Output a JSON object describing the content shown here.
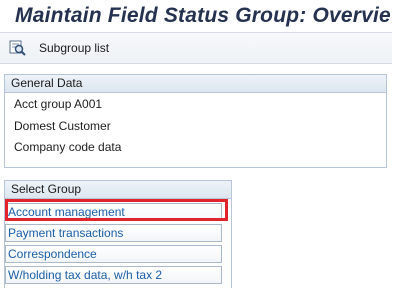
{
  "window": {
    "title": "Maintain Field Status Group: Overview"
  },
  "toolbar": {
    "subgroup_list_label": "Subgroup list",
    "subgroup_list_icon": "magnifier-list-icon"
  },
  "general_data": {
    "header": "General Data",
    "acct_group": "Acct group   A001",
    "description": "Domest  Customer",
    "company_code": "Company code data"
  },
  "select_group": {
    "header": "Select Group",
    "items": [
      {
        "label": "Account management"
      },
      {
        "label": "Payment transactions"
      },
      {
        "label": "Correspondence"
      },
      {
        "label": "W/holding tax data, w/h tax 2"
      }
    ]
  },
  "colors": {
    "title": "#24324f",
    "link": "#1a5ea6",
    "highlight": "#e1232b"
  }
}
